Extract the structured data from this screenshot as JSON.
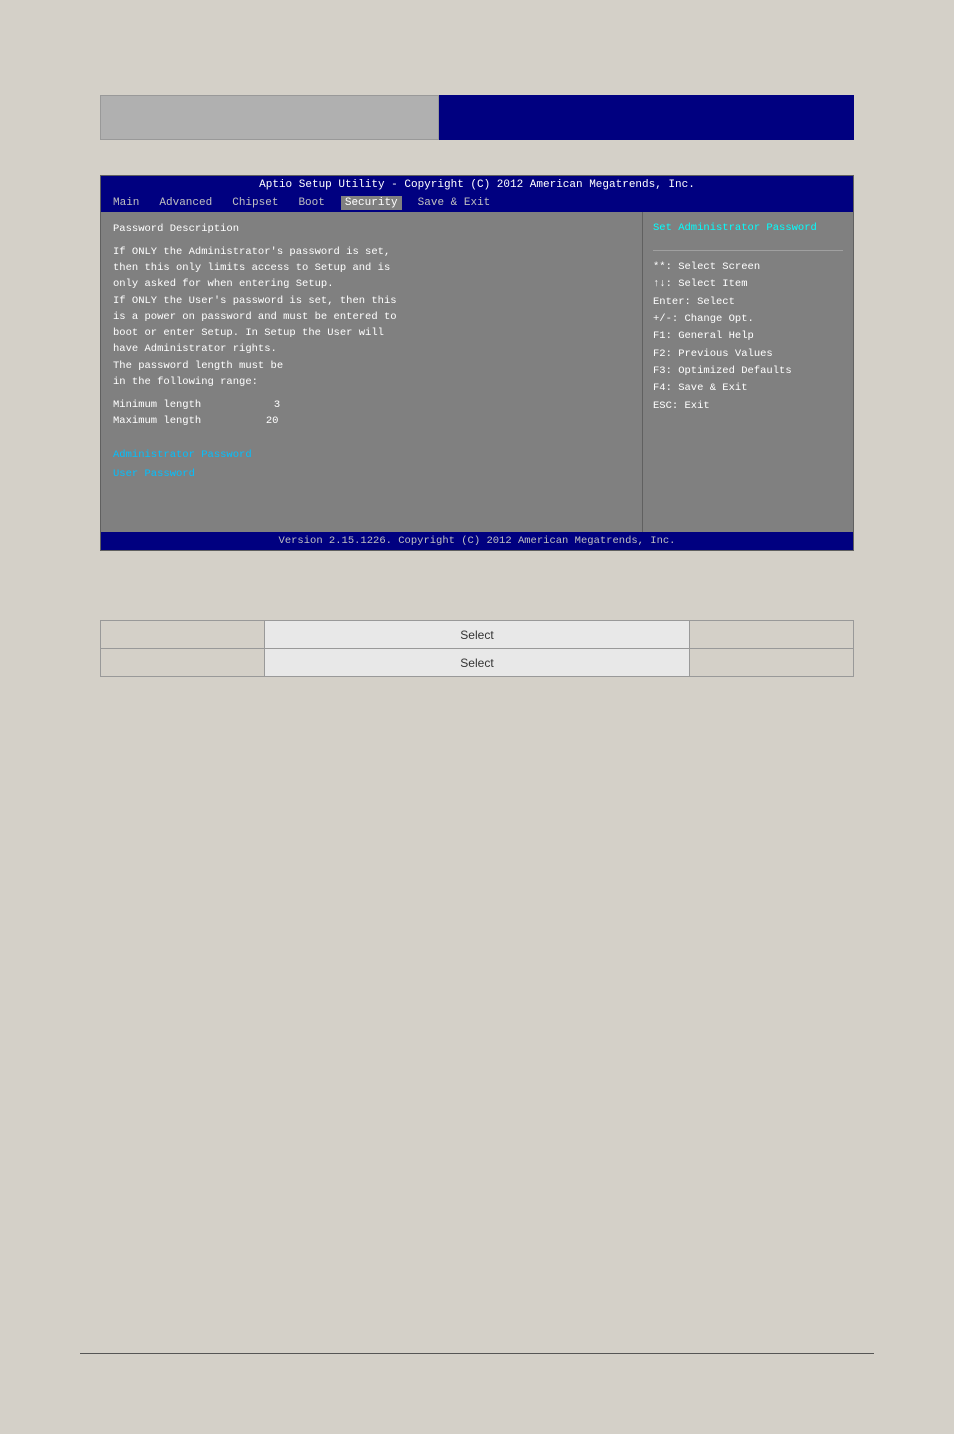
{
  "header": {
    "left_bar": "",
    "right_bar": ""
  },
  "bios": {
    "title": "Aptio Setup Utility - Copyright (C) 2012 American Megatrends, Inc.",
    "menu_items": [
      {
        "label": "Main",
        "active": false
      },
      {
        "label": "Advanced",
        "active": false
      },
      {
        "label": "Chipset",
        "active": false
      },
      {
        "label": "Boot",
        "active": false
      },
      {
        "label": "Security",
        "active": true
      },
      {
        "label": "Save & Exit",
        "active": false
      }
    ],
    "left_panel": {
      "section_title": "Password Description",
      "description_lines": [
        "If ONLY the Administrator's password is set,",
        "then this only limits access to Setup and is",
        "only asked for when entering Setup.",
        "If ONLY the User's password is set, then this",
        "is a power on password and must be entered to",
        "boot or enter Setup. In Setup the User will",
        "have Administrator rights.",
        "The password length must be",
        "in the following range:"
      ],
      "minimum_label": "Minimum length",
      "minimum_value": "3",
      "maximum_label": "Maximum length",
      "maximum_value": "20",
      "password_items": [
        {
          "label": "Administrator Password"
        },
        {
          "label": "User Password"
        }
      ]
    },
    "right_panel": {
      "title": "Set Administrator Password",
      "help_items": [
        "**: Select Screen",
        "↑↓: Select Item",
        "Enter: Select",
        "+/-: Change Opt.",
        "F1: General Help",
        "F2: Previous Values",
        "F3: Optimized Defaults",
        "F4: Save & Exit",
        "ESC: Exit"
      ]
    },
    "version": "Version 2.15.1226. Copyright (C) 2012 American Megatrends, Inc."
  },
  "table": {
    "col1_row1": "",
    "col2_row1": "Select",
    "col3_row1": "",
    "col1_row2": "",
    "col2_row2": "Select",
    "col3_row2": ""
  }
}
